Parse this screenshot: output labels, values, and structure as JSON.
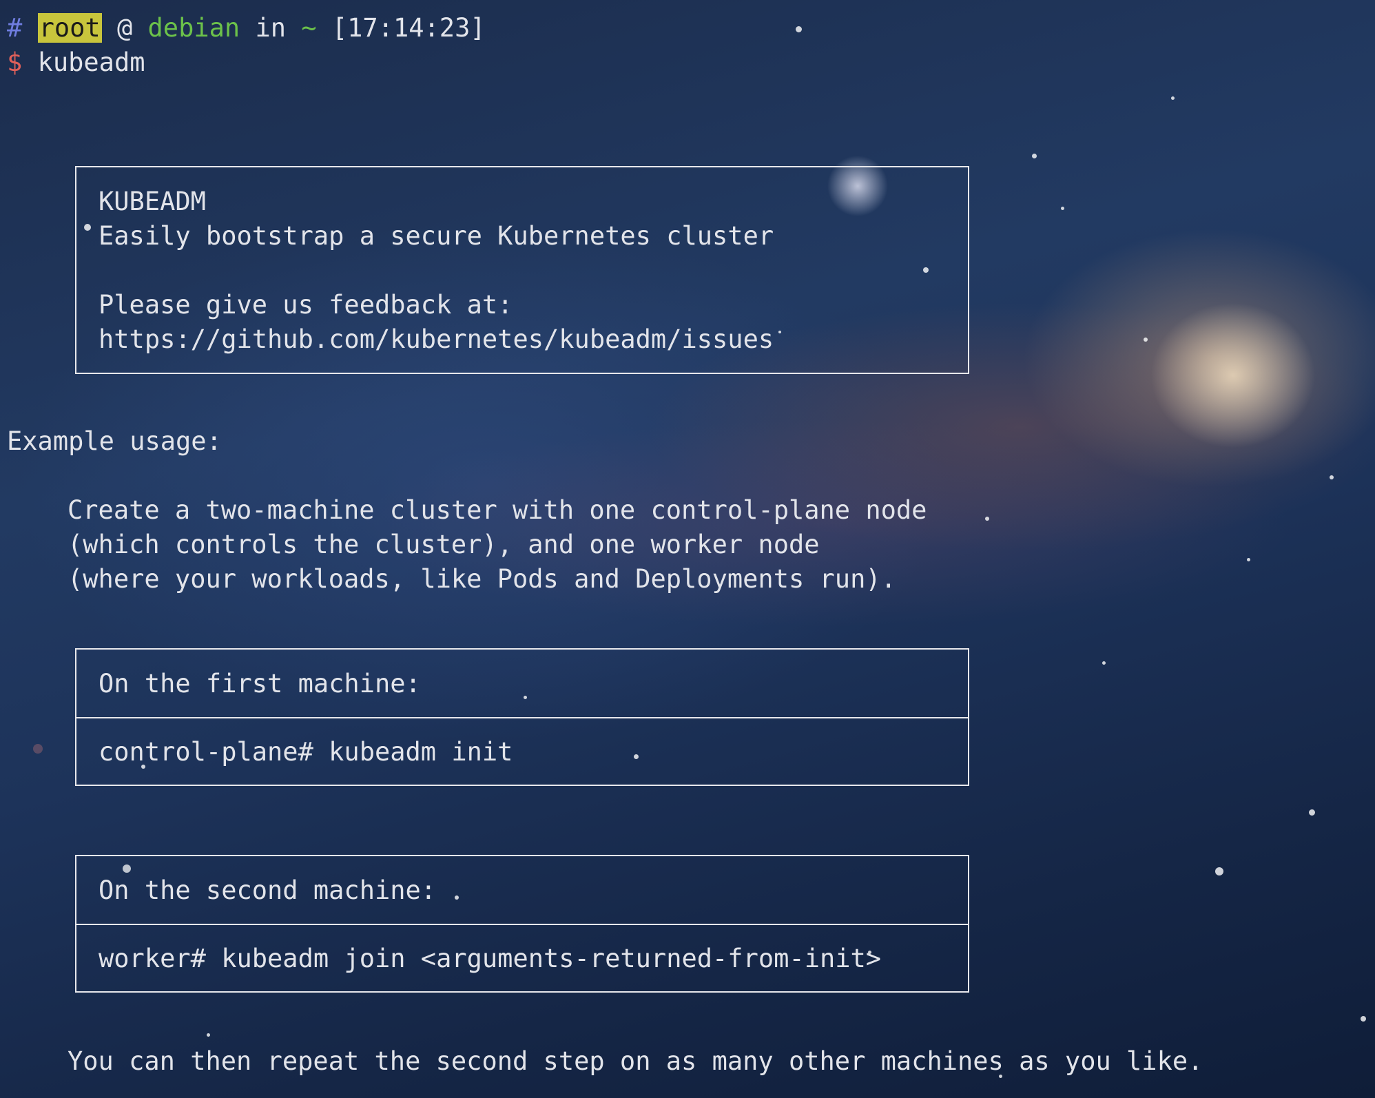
{
  "prompt": {
    "hash": "#",
    "user": "root",
    "at": "@",
    "host": "debian",
    "in": "in",
    "path": "~",
    "time": "[17:14:23]",
    "dollar": "$",
    "command": "kubeadm"
  },
  "banner": {
    "title": "KUBEADM",
    "subtitle": "Easily bootstrap a secure Kubernetes cluster",
    "feedback": "Please give us feedback at:",
    "url": "https://github.com/kubernetes/kubeadm/issues"
  },
  "example": {
    "heading": "Example usage:",
    "description": [
      "Create a two-machine cluster with one control-plane node",
      "(which controls the cluster), and one worker node",
      "(where your workloads, like Pods and Deployments run)."
    ],
    "first_machine": {
      "label": "On the first machine:",
      "command": "control-plane# kubeadm init"
    },
    "second_machine": {
      "label": "On the second machine:",
      "command": "worker# kubeadm join <arguments-returned-from-init>"
    },
    "footer": "You can then repeat the second step on as many other machines as you like."
  }
}
